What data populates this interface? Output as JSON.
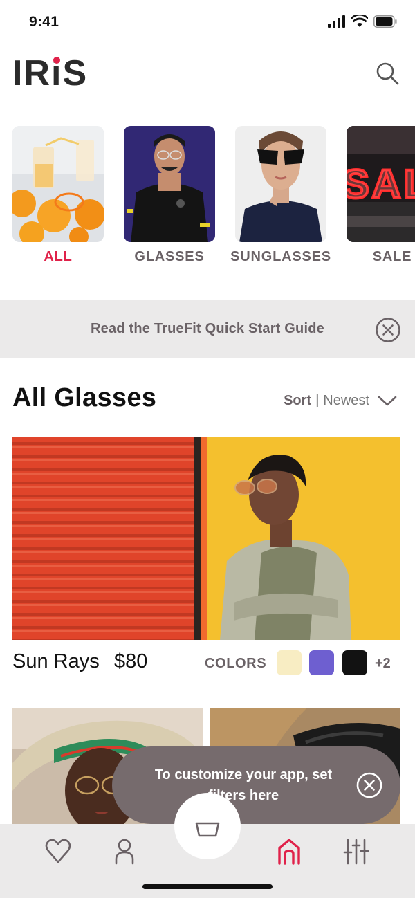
{
  "status_bar": {
    "time": "9:41"
  },
  "header": {
    "logo": "IRiS",
    "logo_parts": [
      "IR",
      "i",
      "S"
    ]
  },
  "categories": [
    {
      "label": "ALL",
      "active": true
    },
    {
      "label": "GLASSES",
      "active": false
    },
    {
      "label": "SUNGLASSES",
      "active": false
    },
    {
      "label": "SALE",
      "active": false
    }
  ],
  "banner": {
    "text": "Read the TrueFit Quick Start Guide"
  },
  "section": {
    "title": "All Glasses",
    "sort_label": "Sort",
    "sort_separator": "|",
    "sort_value": "Newest"
  },
  "product": {
    "name": "Sun Rays",
    "price": "$80",
    "colors_label": "COLORS",
    "swatches": [
      "#f8edc3",
      "#6e5fd0",
      "#121212"
    ],
    "more_colors": "+2"
  },
  "tooltip": {
    "text": "To customize your app, set filters here"
  },
  "theme": {
    "accent": "#e0224a",
    "muted": "#6a6266",
    "tooltip_bg": "#766b6d",
    "panel_bg": "#ebeaea"
  }
}
